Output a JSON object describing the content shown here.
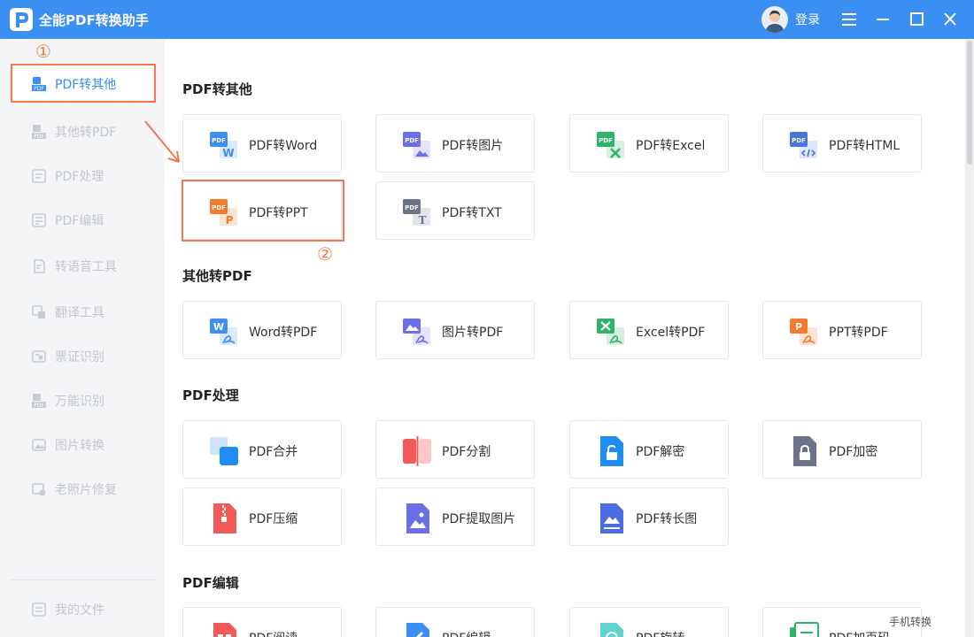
{
  "app": {
    "title": "全能PDF转换助手",
    "login_label": "登录",
    "brand_color": "#3b8ff3",
    "accent_color": "#f07a4c"
  },
  "sidebar": {
    "items": [
      {
        "label": "PDF转其他",
        "icon": "pdf-convert-icon",
        "active": true
      },
      {
        "label": "其他转PDF",
        "icon": "to-pdf-icon"
      },
      {
        "label": "PDF处理",
        "icon": "pdf-process-icon"
      },
      {
        "label": "PDF编辑",
        "icon": "pdf-edit-icon"
      },
      {
        "label": "转语音工具",
        "icon": "voice-icon"
      },
      {
        "label": "翻译工具",
        "icon": "translate-icon"
      },
      {
        "label": "票证识别",
        "icon": "ticket-icon"
      },
      {
        "label": "万能识别",
        "icon": "ocr-icon"
      },
      {
        "label": "图片转换",
        "icon": "image-convert-icon"
      },
      {
        "label": "老照片修复",
        "icon": "photo-repair-icon"
      }
    ],
    "my_files": "我的文件"
  },
  "sections": [
    {
      "title": "PDF转其他",
      "items": [
        "PDF转Word",
        "PDF转图片",
        "PDF转Excel",
        "PDF转HTML",
        "PDF转PPT",
        "PDF转TXT"
      ]
    },
    {
      "title": "其他转PDF",
      "items": [
        "Word转PDF",
        "图片转PDF",
        "Excel转PDF",
        "PPT转PDF"
      ]
    },
    {
      "title": "PDF处理",
      "items": [
        "PDF合并",
        "PDF分割",
        "PDF解密",
        "PDF加密",
        "PDF压缩",
        "PDF提取图片",
        "PDF转长图"
      ]
    },
    {
      "title": "PDF编辑",
      "items": [
        "PDF阅读",
        "PDF编辑",
        "PDF旋转",
        "PDF加页码"
      ]
    }
  ],
  "annotations": {
    "step1": "①",
    "step2": "②"
  },
  "footer": {
    "mobile": "手机转换"
  }
}
